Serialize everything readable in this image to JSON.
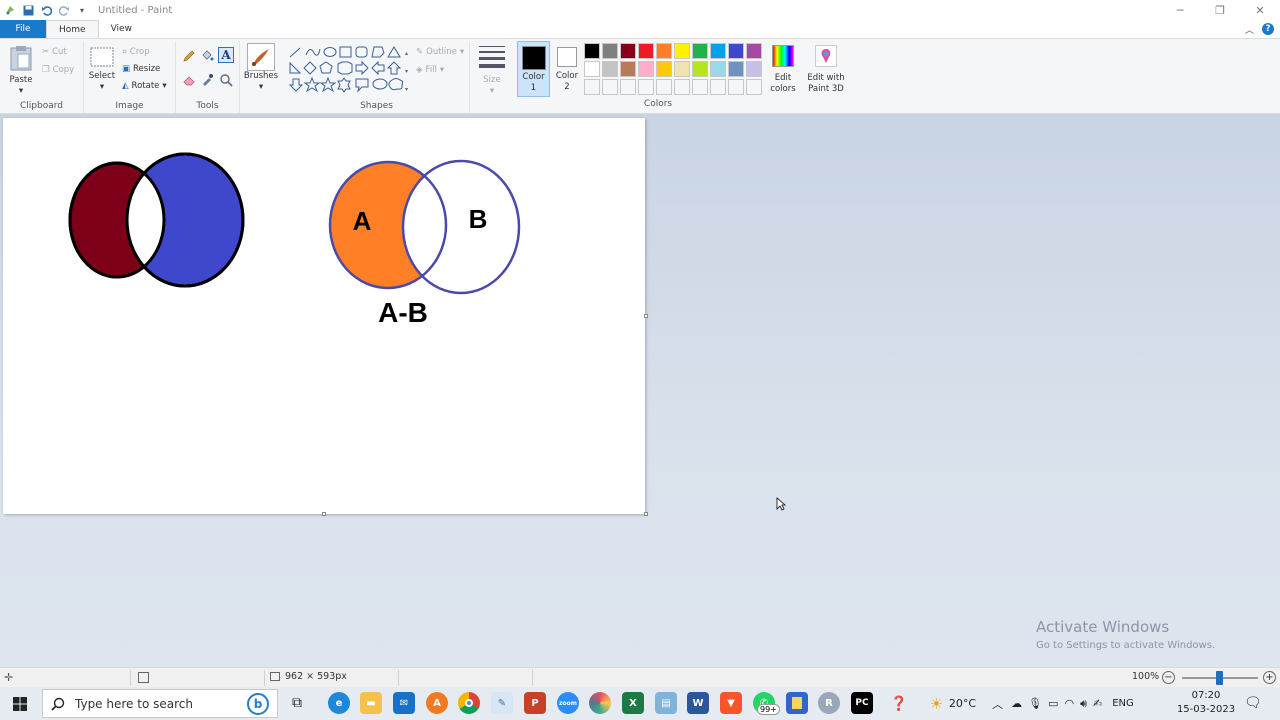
{
  "window": {
    "title": "Untitled - Paint",
    "controls": {
      "minimize": "─",
      "maximize": "❐",
      "close": "✕"
    }
  },
  "tabs": {
    "file": "File",
    "home": "Home",
    "view": "View"
  },
  "ribbon": {
    "clipboard": {
      "paste": "Paste",
      "cut": "Cut",
      "copy": "Copy",
      "label": "Clipboard"
    },
    "image": {
      "select": "Select",
      "crop": "Crop",
      "resize": "Resize",
      "rotate": "Rotate",
      "label": "Image"
    },
    "tools": {
      "label": "Tools"
    },
    "brushes": {
      "label": "Brushes"
    },
    "shapes": {
      "outline": "Outline",
      "fill": "Fill",
      "label": "Shapes"
    },
    "size": {
      "label": "Size"
    },
    "color1": {
      "line1": "Color",
      "line2": "1"
    },
    "color2": {
      "line1": "Color",
      "line2": "2"
    },
    "colors": {
      "label": "Colors"
    },
    "edit_colors": {
      "line1": "Edit",
      "line2": "colors"
    },
    "paint3d": {
      "line1": "Edit with",
      "line2": "Paint 3D"
    },
    "palette_row1": [
      "#000000",
      "#7f7f7f",
      "#880015",
      "#ed1c24",
      "#ff7f27",
      "#fff200",
      "#22b14c",
      "#00a2e8",
      "#3f48cc",
      "#a349a4"
    ],
    "palette_row2": [
      "#ffffff",
      "#c3c3c3",
      "#b97a57",
      "#ffaec9",
      "#ffc90e",
      "#efe4b0",
      "#b5e61d",
      "#99d9ea",
      "#7092be",
      "#c8bfe7"
    ]
  },
  "canvas": {
    "diagram": {
      "label_a": "A",
      "label_b": "B",
      "caption": "A-B"
    },
    "colors": {
      "dark_red": "#7d0018",
      "blue": "#3f48cc",
      "orange": "#ff7f27",
      "outline_purple": "#4a4aa8"
    }
  },
  "activate": {
    "title": "Activate Windows",
    "subtitle": "Go to Settings to activate Windows."
  },
  "statusbar": {
    "dimensions": "962 × 593px",
    "zoom": "100%"
  },
  "taskbar": {
    "search_placeholder": "Type here to search",
    "weather": "20°C",
    "language": "ENG",
    "time": "07:20",
    "date": "15-03-2023",
    "whatsapp_badge": "99+"
  }
}
